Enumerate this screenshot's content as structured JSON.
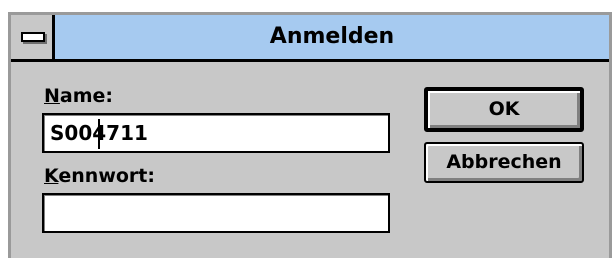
{
  "dialog": {
    "title": "Anmelden",
    "system_menu_icon": "system-menu-icon"
  },
  "name_field": {
    "label_mnemonic": "N",
    "label_rest": "ame:",
    "value": "S004711"
  },
  "password_field": {
    "label_mnemonic": "K",
    "label_rest": "ennwort:",
    "value": ""
  },
  "buttons": {
    "ok": "OK",
    "cancel": "Abbrechen"
  },
  "colors": {
    "titlebar": "#a6caf0",
    "dialog_face": "#c8c8c8"
  }
}
